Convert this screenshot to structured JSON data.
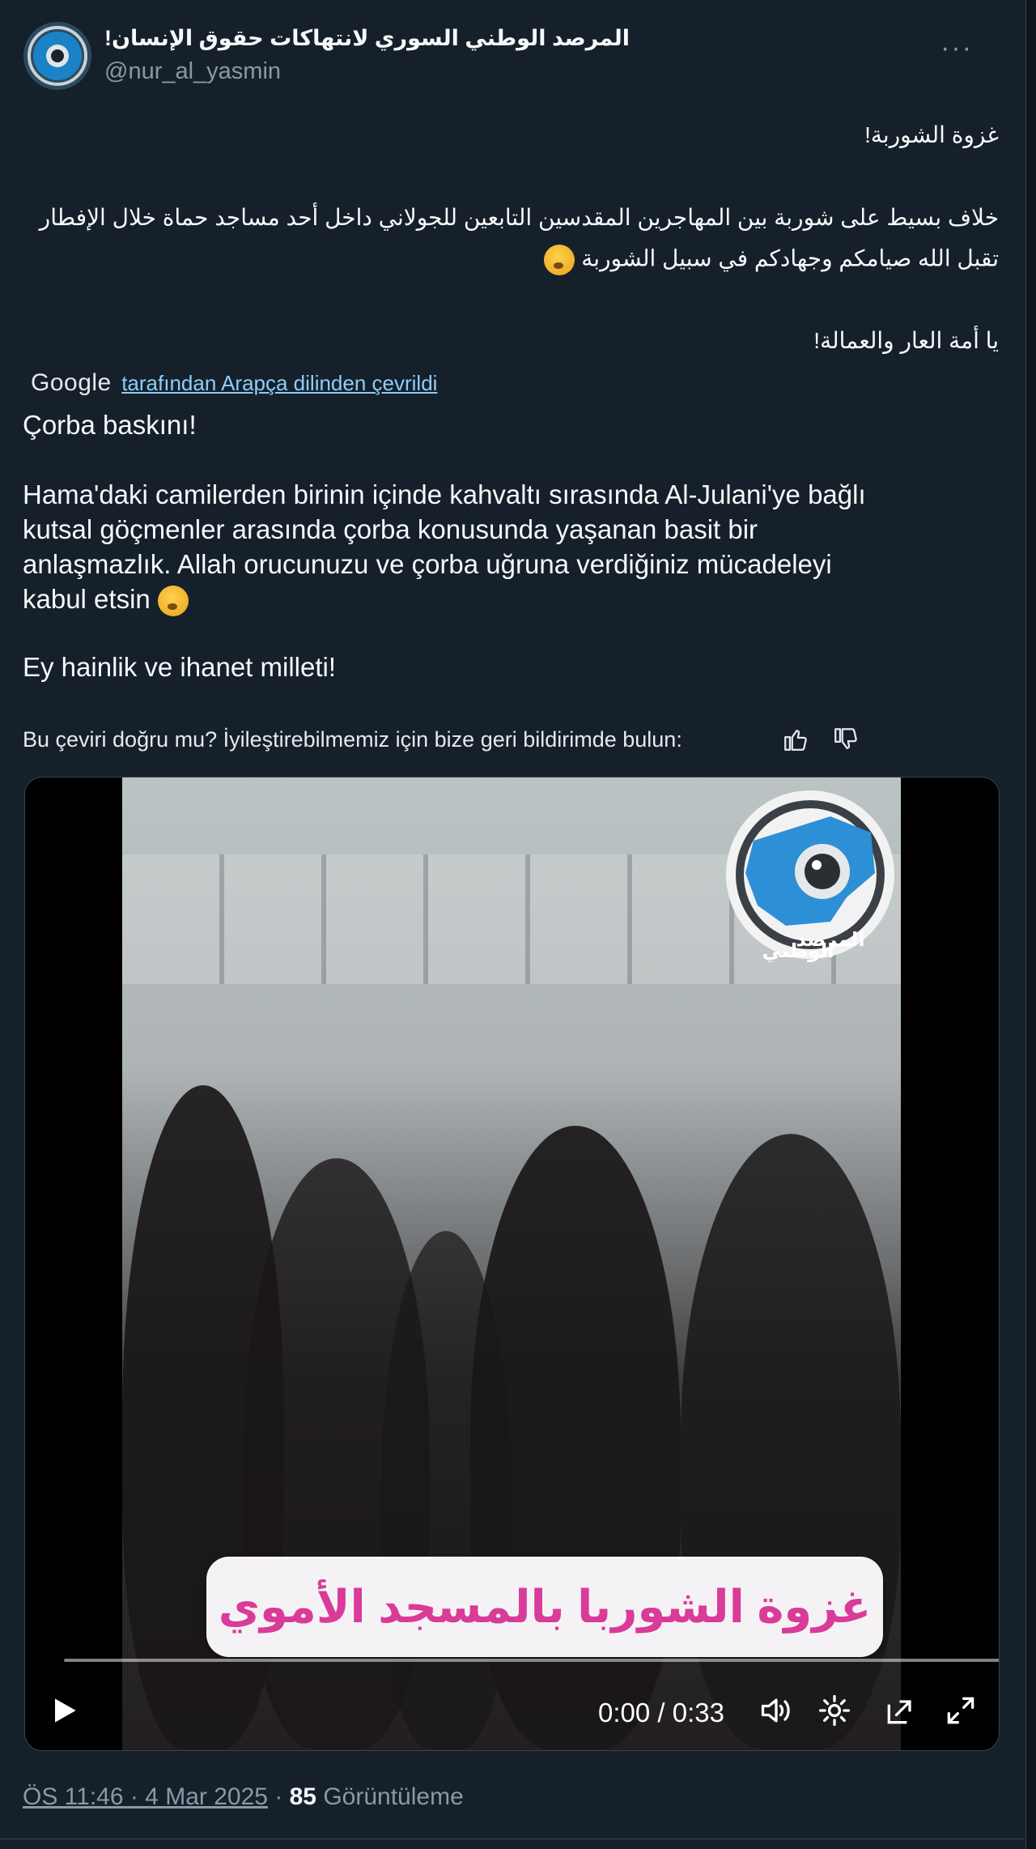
{
  "tweet": {
    "author": {
      "display_name": "المرصد الوطني السوري لانتهاكات حقوق الإنسان!",
      "handle": "@nur_al_yasmin",
      "more_label": "···"
    },
    "original_text": {
      "line1": "غزوة الشوربة!",
      "line2": "خلاف بسيط على شوربة بين المهاجرين المقدسين التابعين للجولاني داخل أحد مساجد حماة خلال الإفطار",
      "line3": "تقبل الله صيامكم وجهادكم في سبيل الشوربة",
      "line4": "يا أمة العار والعمالة!"
    },
    "translation": {
      "provider": "Google",
      "link_text": "tarafından Arapça dilinden çevrildi",
      "p1": "Çorba baskını!",
      "p2_line1": "Hama'daki camilerden birinin içinde kahvaltı sırasında Al-Julani'ye bağlı",
      "p2_line2": "kutsal göçmenler arasında çorba konusunda yaşanan basit bir",
      "p2_line3": "anlaşmazlık. Allah orucunuzu ve çorba uğruna verdiğiniz mücadeleyi",
      "p2_line4": "kabul etsin",
      "p3": "Ey hainlik ve ihanet milleti!",
      "feedback_prompt": "Bu çeviri doğru mu? İyileştirebilmemiz için bize geri bildirimde bulun:"
    },
    "video": {
      "overlay_caption": "غزوة الشوربا بالمسجد الأموي",
      "logo_text_line1": "المرصد",
      "logo_text_line2": "الوطني",
      "time_display": "0:00 / 0:33",
      "progress": 0.0
    },
    "meta": {
      "time_date": "ÖS 11:46 · 4 Mar 2025",
      "separator": " · ",
      "views_count": "85",
      "views_label": "Görüntüleme"
    }
  },
  "colors": {
    "background": "#15202b",
    "text_primary": "#f7f9f9",
    "text_secondary": "#8b98a5",
    "link": "#8ecdf8",
    "caption_pink": "#d93b98"
  }
}
